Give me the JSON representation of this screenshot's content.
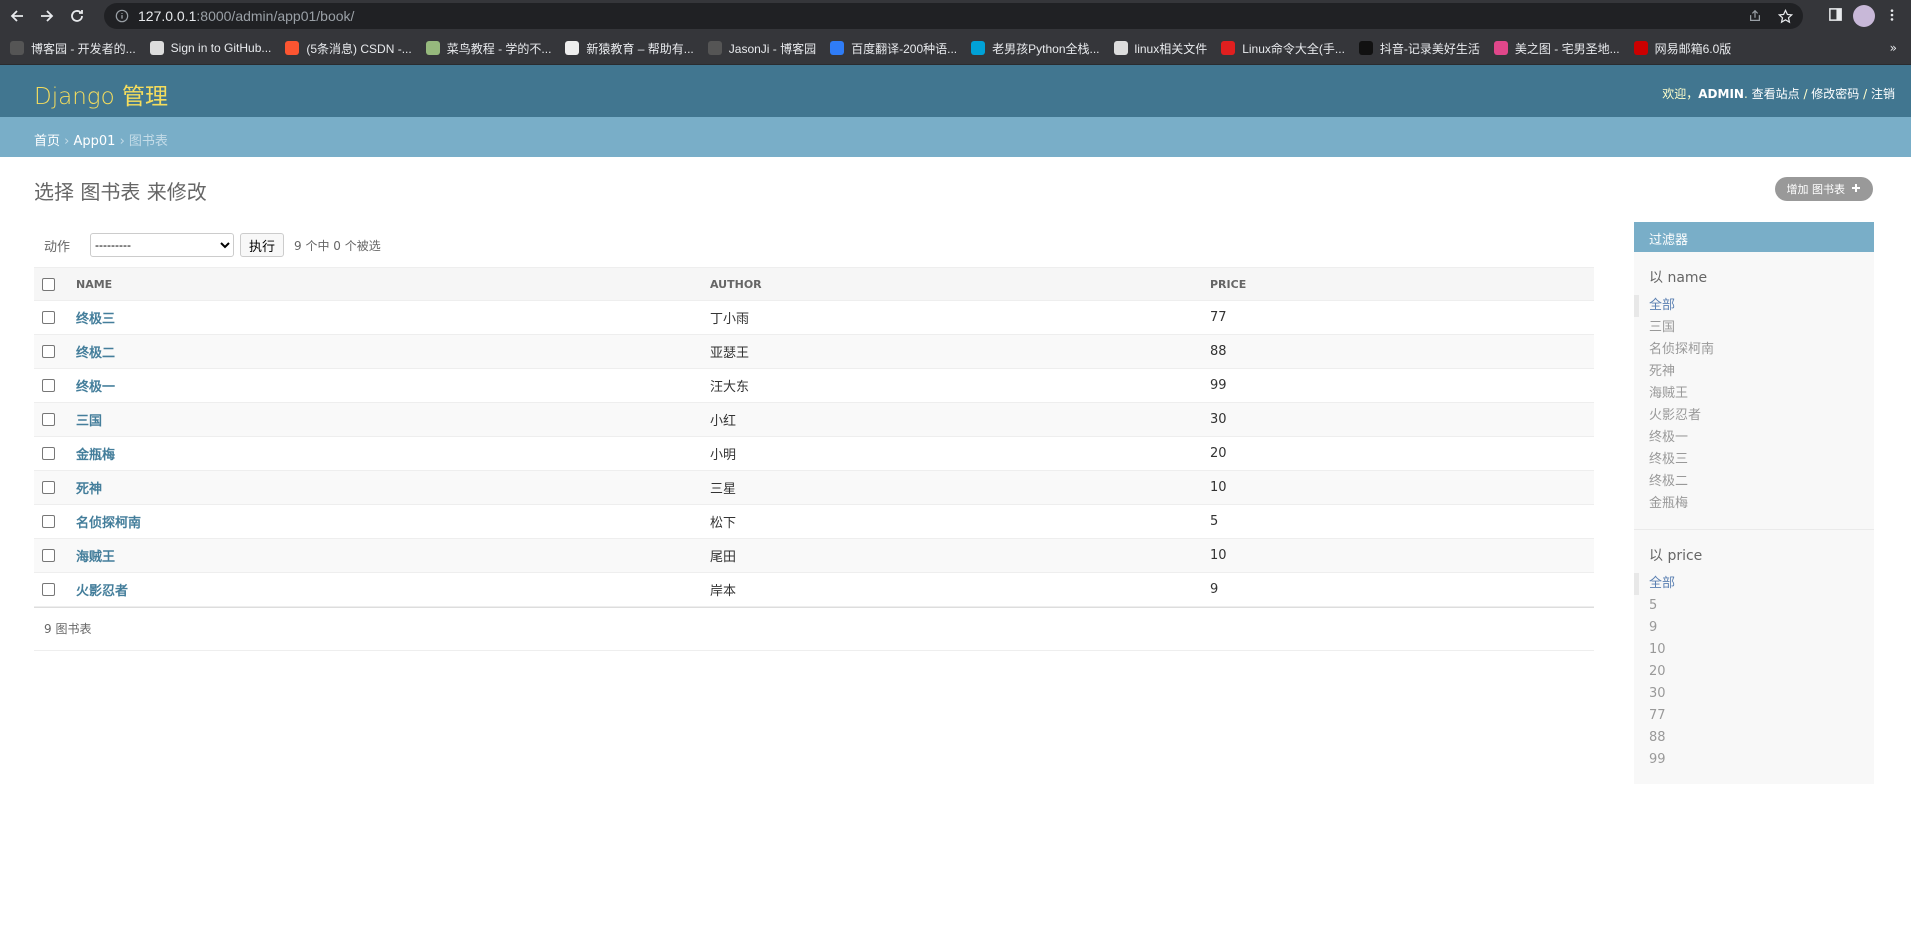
{
  "browser": {
    "url_host": "127.0.0.1",
    "url_rest": ":8000/admin/app01/book/",
    "bookmarks": [
      {
        "label": "博客园 - 开发者的...",
        "color": "#555"
      },
      {
        "label": "Sign in to GitHub...",
        "color": "#ddd"
      },
      {
        "label": "(5条消息) CSDN -...",
        "color": "#fc5531"
      },
      {
        "label": "菜鸟教程 - 学的不...",
        "color": "#96b97d"
      },
      {
        "label": "新猿教育 – 帮助有...",
        "color": "#eee"
      },
      {
        "label": "JasonJi - 博客园",
        "color": "#555"
      },
      {
        "label": "百度翻译-200种语...",
        "color": "#2f7cf6"
      },
      {
        "label": "老男孩Python全栈...",
        "color": "#00a1d6"
      },
      {
        "label": "linux相关文件",
        "color": "#ddd"
      },
      {
        "label": "Linux命令大全(手...",
        "color": "#e01f1f"
      },
      {
        "label": "抖音-记录美好生活",
        "color": "#111"
      },
      {
        "label": "美之图 - 宅男圣地...",
        "color": "#e0478a"
      },
      {
        "label": "网易邮箱6.0版",
        "color": "#c00"
      }
    ],
    "more": "»"
  },
  "header": {
    "brand": "Django 管理",
    "welcome": "欢迎，",
    "user": "ADMIN",
    "view_site": "查看站点",
    "change_password": "修改密码",
    "logout": "注销",
    "sep": " / "
  },
  "breadcrumbs": {
    "home": "首页",
    "app": "App01",
    "current": "图书表",
    "sep": " › "
  },
  "content": {
    "title": "选择 图书表 来修改",
    "add_label": "增加 图书表",
    "action_label": "动作",
    "action_selected": "---------",
    "go_label": "执行",
    "counter": "9 个中 0 个被选",
    "columns": [
      "NAME",
      "AUTHOR",
      "PRICE"
    ],
    "rows": [
      {
        "name": "终极三",
        "author": "丁小雨",
        "price": "77"
      },
      {
        "name": "终极二",
        "author": "亚瑟王",
        "price": "88"
      },
      {
        "name": "终极一",
        "author": "汪大东",
        "price": "99"
      },
      {
        "name": "三国",
        "author": "小红",
        "price": "30"
      },
      {
        "name": "金瓶梅",
        "author": "小明",
        "price": "20"
      },
      {
        "name": "死神",
        "author": "三星",
        "price": "10"
      },
      {
        "name": "名侦探柯南",
        "author": "松下",
        "price": "5"
      },
      {
        "name": "海贼王",
        "author": "尾田",
        "price": "10"
      },
      {
        "name": "火影忍者",
        "author": "岸本",
        "price": "9"
      }
    ],
    "paginator": "9 图书表"
  },
  "filter": {
    "title": "过滤器",
    "groups": [
      {
        "title": "以 name",
        "items": [
          "全部",
          "三国",
          "名侦探柯南",
          "死神",
          "海贼王",
          "火影忍者",
          "终极一",
          "终极三",
          "终极二",
          "金瓶梅"
        ]
      },
      {
        "title": "以 price",
        "items": [
          "全部",
          "5",
          "9",
          "10",
          "20",
          "30",
          "77",
          "88",
          "99"
        ]
      }
    ]
  },
  "colors": {
    "header": "#417690",
    "breadcrumbs": "#79aec8",
    "brand": "#f5dd5d",
    "link": "#447e9b"
  }
}
